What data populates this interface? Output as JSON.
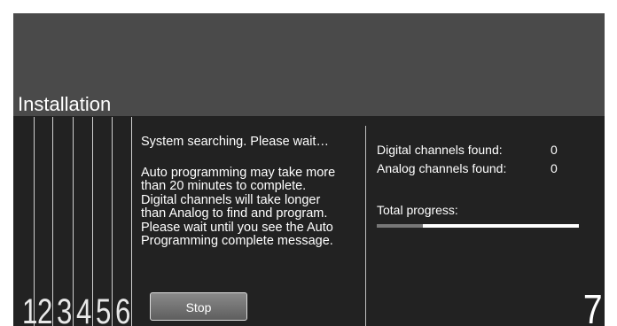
{
  "header": {
    "title": "Installation"
  },
  "left_panel": {
    "search_status": "System searching. Please wait…",
    "lines": [
      "Auto programming may take more",
      "than 20 minutes to complete.",
      "Digital channels will take longer",
      "than Analog to find and program.",
      "Please wait until you see the Auto",
      "Programming complete message."
    ],
    "stop_label": "Stop"
  },
  "right_panel": {
    "digital_label": "Digital channels found:",
    "digital_count": "0",
    "analog_label": "Analog channels found:",
    "analog_count": "0",
    "total_label": "Total progress:",
    "progress_fraction": 0.23
  },
  "annotation_numbers": [
    "1",
    "2",
    "3",
    "4",
    "5",
    "6",
    "7"
  ],
  "colors": {
    "screen_bg": "#222222",
    "header_bg": "#4a4a4a",
    "text": "#ffffff",
    "progress_fill": "#777777"
  }
}
